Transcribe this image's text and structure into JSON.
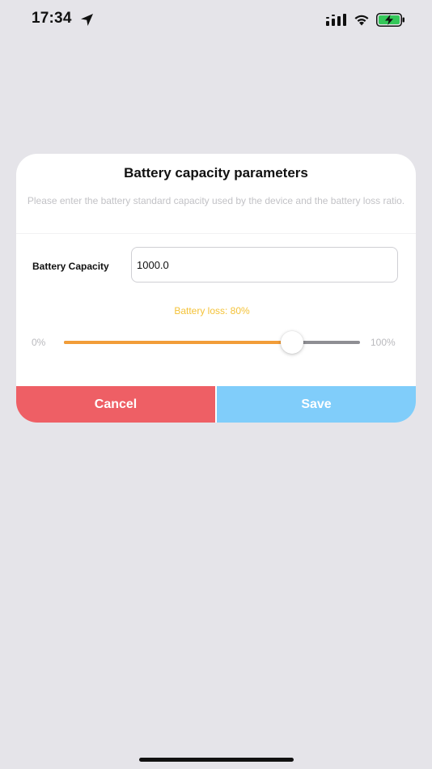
{
  "status_bar": {
    "time": "17:34",
    "icons": [
      "location-arrow-icon",
      "cellular-signal-icon",
      "wifi-icon",
      "battery-charging-icon"
    ]
  },
  "dialog": {
    "title": "Battery capacity parameters",
    "description": "Please enter the battery standard capacity used by the device and the battery loss ratio.",
    "capacity_label": "Battery Capacity",
    "capacity_value": "1000.0",
    "loss_text": "Battery loss: 80%",
    "slider": {
      "min_label": "0%",
      "max_label": "100%",
      "value_fraction": 0.77
    },
    "cancel_label": "Cancel",
    "save_label": "Save"
  },
  "colors": {
    "background": "#e5e4e9",
    "loss_text": "#f4c238",
    "slider_fill": "#f29d38",
    "cancel_button": "#ee5f65",
    "save_button": "#80cdfa"
  }
}
